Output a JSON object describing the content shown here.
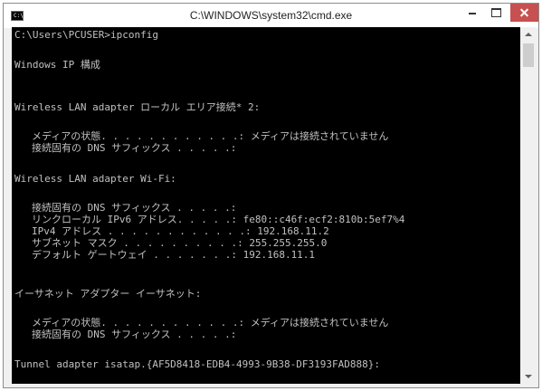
{
  "window": {
    "title": "C:\\WINDOWS\\system32\\cmd.exe",
    "icon_name": "console-icon",
    "icon_text": "C:\\",
    "close_color": "#c75050"
  },
  "console": {
    "text_color": "#c0c0c0",
    "background": "#000000",
    "lines": [
      "C:\\Users\\PCUSER>ipconfig",
      "Windows IP 構成",
      "Wireless LAN adapter ローカル エリア接続* 2:",
      "メディアの状態. . . . . . . . . . . .: メディアは接続されていません",
      "接続固有の DNS サフィックス . . . . .:",
      "Wireless LAN adapter Wi-Fi:",
      "接続固有の DNS サフィックス . . . . .:",
      "リンクローカル IPv6 アドレス. . . . .: fe80::c46f:ecf2:810b:5ef7%4",
      "IPv4 アドレス . . . . . . . . . . . .: 192.168.11.2",
      "サブネット マスク . . . . . . . . . .: 255.255.255.0",
      "デフォルト ゲートウェイ . . . . . . .: 192.168.11.1",
      "イーサネット アダプター イーサネット:",
      "メディアの状態. . . . . . . . . . . .: メディアは接続されていません",
      "接続固有の DNS サフィックス . . . . .:",
      "Tunnel adapter isatap.{AF5D8418-EDB4-4993-9B38-DF3193FAD888}:"
    ]
  }
}
